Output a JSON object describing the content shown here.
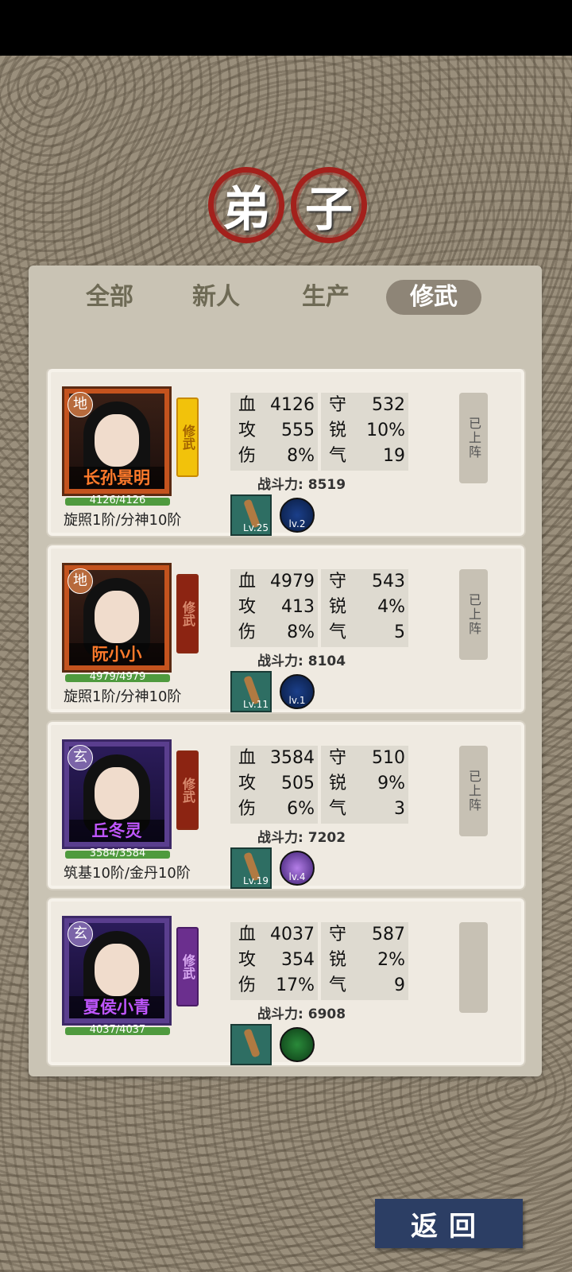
{
  "title": {
    "char1": "弟",
    "char2": "子"
  },
  "tabs": [
    {
      "label": "全部",
      "active": false
    },
    {
      "label": "新人",
      "active": false
    },
    {
      "label": "生产",
      "active": false
    },
    {
      "label": "修武",
      "active": true
    }
  ],
  "disciples": [
    {
      "grade": "地",
      "name": "长孙景明",
      "hp": "4126/4126",
      "realm": "旋照1阶/分神10阶",
      "role_tag": "修武",
      "stats": {
        "blood": "4126",
        "attack": "555",
        "damage": "8%",
        "defense": "532",
        "sharp": "10%",
        "qi": "19"
      },
      "power_label": "战斗力:",
      "power": "8519",
      "equip_level": "Lv.25",
      "skill_level": "lv.2",
      "deploy": "已上阵"
    },
    {
      "grade": "地",
      "name": "阮小小",
      "hp": "4979/4979",
      "realm": "旋照1阶/分神10阶",
      "role_tag": "修武",
      "stats": {
        "blood": "4979",
        "attack": "413",
        "damage": "8%",
        "defense": "543",
        "sharp": "4%",
        "qi": "5"
      },
      "power_label": "战斗力:",
      "power": "8104",
      "equip_level": "Lv.11",
      "skill_level": "lv.1",
      "deploy": "已上阵"
    },
    {
      "grade": "玄",
      "name": "丘冬灵",
      "hp": "3584/3584",
      "realm": "筑基10阶/金丹10阶",
      "role_tag": "修武",
      "stats": {
        "blood": "3584",
        "attack": "505",
        "damage": "6%",
        "defense": "510",
        "sharp": "9%",
        "qi": "3"
      },
      "power_label": "战斗力:",
      "power": "7202",
      "equip_level": "Lv.19",
      "skill_level": "lv.4",
      "deploy": "已上阵"
    },
    {
      "grade": "玄",
      "name": "夏侯小青",
      "hp": "4037/4037",
      "realm": "",
      "role_tag": "修武",
      "stats": {
        "blood": "4037",
        "attack": "354",
        "damage": "17%",
        "defense": "587",
        "sharp": "2%",
        "qi": "9"
      },
      "power_label": "战斗力:",
      "power": "6908",
      "equip_level": "",
      "skill_level": "",
      "deploy": ""
    }
  ],
  "stat_labels": {
    "blood": "血",
    "attack": "攻",
    "damage": "伤",
    "defense": "守",
    "sharp": "锐",
    "qi": "气"
  },
  "back_label": "返回"
}
